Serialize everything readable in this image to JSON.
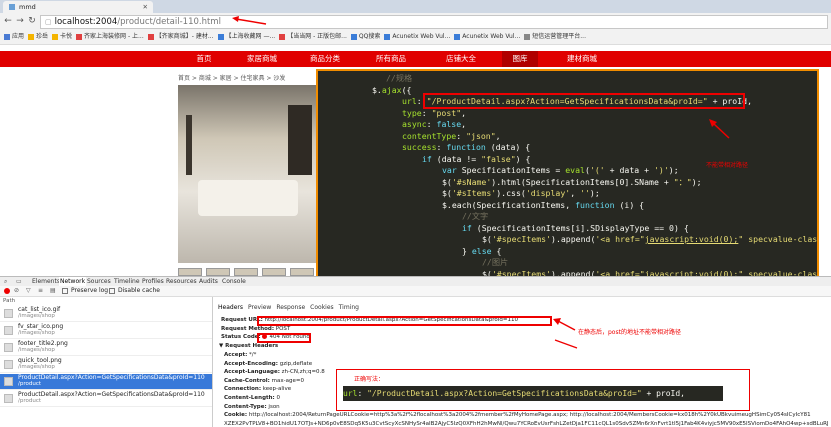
{
  "browser": {
    "tab_title": "mmd",
    "address_host": "localhost:2004",
    "address_path": "/product/detail-110.html",
    "bookmarks": [
      {
        "label": "应用",
        "color": "#4a7bd3"
      },
      {
        "label": "珍岳",
        "color": "#f4b400"
      },
      {
        "label": "卡悦",
        "color": "#f4b400"
      },
      {
        "label": "齐家上海装修网 - 上...",
        "color": "#e04040"
      },
      {
        "label": "【齐家商城】- 建材...",
        "color": "#e04040"
      },
      {
        "label": "【上海收藏网 —...",
        "color": "#3b7dd8"
      },
      {
        "label": "【当当网 - 正版包邮...",
        "color": "#e04040"
      },
      {
        "label": "QQ搜索",
        "color": "#3b7dd8"
      },
      {
        "label": "Acunetix Web Vul...",
        "color": "#3b7dd8"
      },
      {
        "label": "Acunetix Web Vul...",
        "color": "#3b7dd8"
      },
      {
        "label": "短信运营管理平台...",
        "color": "#888888"
      }
    ]
  },
  "site": {
    "nav": [
      "首页",
      "家居商城",
      "商品分类",
      "所有商品",
      "店铺大全",
      "图库",
      "建材商城"
    ],
    "breadcrumb": "首页 > 商城 > 家居 > 住宅家具 > 沙发"
  },
  "code_lines": [
    [
      [
        "cm",
        "//规格"
      ]
    ],
    [
      [
        "wh",
        "$."
      ],
      [
        "fn",
        "ajax"
      ],
      [
        "wh",
        "({"
      ]
    ],
    [
      [
        "prop",
        "url"
      ],
      [
        "wh",
        ": "
      ],
      [
        "str",
        "\"/ProductDetail.aspx?Action=GetSpecificationsData&proId=\""
      ],
      [
        "wh",
        " + proId,"
      ]
    ],
    [
      [
        "prop",
        "type"
      ],
      [
        "wh",
        ": "
      ],
      [
        "str",
        "\"post\""
      ],
      [
        "wh",
        ","
      ]
    ],
    [
      [
        "prop",
        "async"
      ],
      [
        "wh",
        ": "
      ],
      [
        "kw",
        "false"
      ],
      [
        "wh",
        ","
      ]
    ],
    [
      [
        "prop",
        "contentType"
      ],
      [
        "wh",
        ": "
      ],
      [
        "str",
        "\"json\""
      ],
      [
        "wh",
        ","
      ]
    ],
    [
      [
        "prop",
        "success"
      ],
      [
        "wh",
        ": "
      ],
      [
        "kw",
        "function"
      ],
      [
        "wh",
        " (data) {"
      ]
    ],
    [
      [
        "kw",
        "if"
      ],
      [
        "wh",
        " (data != "
      ],
      [
        "str",
        "\"false\""
      ],
      [
        "wh",
        ") {"
      ]
    ],
    [
      [
        "kw",
        "var"
      ],
      [
        "wh",
        " SpecificationItems = "
      ],
      [
        "fn",
        "eval"
      ],
      [
        "wh",
        "("
      ],
      [
        "str",
        "'('"
      ],
      [
        "wh",
        " + data + "
      ],
      [
        "str",
        "')'"
      ],
      [
        "wh",
        ");"
      ]
    ],
    [
      [
        "wh",
        "$("
      ],
      [
        "str",
        "'#sName'"
      ],
      [
        "wh",
        ").html(SpecificationItems[0].SName + "
      ],
      [
        "str",
        "\"：\""
      ],
      [
        "wh",
        ");"
      ]
    ],
    [
      [
        "wh",
        "$("
      ],
      [
        "str",
        "'#sItems'"
      ],
      [
        "wh",
        ").css("
      ],
      [
        "str",
        "'display'"
      ],
      [
        "wh",
        ", "
      ],
      [
        "str",
        "''"
      ],
      [
        "wh",
        ");"
      ]
    ],
    [
      [
        "wh",
        "$.each(SpecificationItems, "
      ],
      [
        "kw",
        "function"
      ],
      [
        "wh",
        " (i) {"
      ]
    ],
    [
      [
        "cm",
        "//文字"
      ]
    ],
    [
      [
        "kw",
        "if"
      ],
      [
        "wh",
        " (SpecificationItems[i].SDisplayType == 0) {"
      ]
    ],
    [
      [
        "wh",
        "$("
      ],
      [
        "str",
        "'#specItems'"
      ],
      [
        "wh",
        ").append("
      ],
      [
        "str",
        "'<a href=\""
      ],
      [
        "lnk",
        "javascript:void(0);"
      ],
      [
        "str",
        "\" specvalue-class=\"nor'"
      ]
    ],
    [
      [
        "wh",
        "} "
      ],
      [
        "kw",
        "else"
      ],
      [
        "wh",
        " {"
      ]
    ],
    [
      [
        "cm",
        "//图片"
      ]
    ],
    [
      [
        "wh",
        "$("
      ],
      [
        "str",
        "'#specItems'"
      ],
      [
        "wh",
        ").append("
      ],
      [
        "str",
        "'<a href=\""
      ],
      [
        "lnk",
        "javascript:void(0);"
      ],
      [
        "str",
        "\" specvalue-class=\"nor'"
      ]
    ]
  ],
  "code_annotation": "不能带相对路径",
  "devtools": {
    "tabs": [
      "Elements",
      "Network",
      "Sources",
      "Timeline",
      "Profiles",
      "Resources",
      "Audits",
      "Console"
    ],
    "toolbar": {
      "preserve_log": "Preserve log",
      "disable_cache": "Disable cache"
    },
    "path_label": "Path",
    "requests": [
      {
        "name": "cat_list_ico.gif",
        "path": "/images/shop"
      },
      {
        "name": "fv_star_ico.png",
        "path": "/images/shop"
      },
      {
        "name": "footer_title2.png",
        "path": "/images/shop"
      },
      {
        "name": "quick_tool.png",
        "path": "/images/shop"
      },
      {
        "name": "ProductDetail.aspx?Action=GetSpecificationsData&proId=110",
        "path": "/product"
      },
      {
        "name": "ProductDetail.aspx?Action=GetSpecificationsData&proId=110",
        "path": "/product"
      }
    ],
    "header_tabs": [
      "Headers",
      "Preview",
      "Response",
      "Cookies",
      "Timing"
    ],
    "general": [
      {
        "key": "Request URL:",
        "value": "http://localhost:2004/product/ProductDetail.aspx?Action=GetSpecificationsData&proId=110"
      },
      {
        "key": "Request Method:",
        "value": "POST"
      },
      {
        "key": "Status Code:",
        "value": "404 Not Found"
      }
    ],
    "request_headers_title": "▼ Request Headers",
    "request_headers": [
      {
        "key": "Accept:",
        "value": "*/*"
      },
      {
        "key": "Accept-Encoding:",
        "value": "gzip,deflate"
      },
      {
        "key": "Accept-Language:",
        "value": "zh-CN,zh;q=0.8"
      },
      {
        "key": "Cache-Control:",
        "value": "max-age=0"
      },
      {
        "key": "Connection:",
        "value": "keep-alive"
      },
      {
        "key": "Content-Length:",
        "value": "0"
      },
      {
        "key": "Content-Type:",
        "value": "json"
      },
      {
        "key": "Cookie:",
        "value": "http://localhost:2004/ReturnPageURLCookie=http%3a%2f%2flocalhost%3a2004%2fmember%2fMyHomePage.aspx; http://localhost:2004/MembersCookie=kx018h%2Y0kUBkvuimeugHSimCy054sICyIcY81"
      },
      {
        "key": "",
        "value": "XZEX2PvTPLV8+BO1hidU17OTJs+ND6p0vE8SDq5K5u3CvtScyXcSNHySr4aIB2AjyC5IzQ0XFhH2hMwNl/Qwu7YCRoEvUsrFshLZetDja1FC11cQL1s0Sdv5ZMn6rXnFvrt1tI5j1Fab4K4viyjc5MV90xE5ISViomDo4FAhO4wp+sdBLuRJ"
      }
    ],
    "annotation_right": "在静态后，post的地址不能带相对路径",
    "correct_title": "正确写法：",
    "correct_code": [
      [
        "prop",
        "url"
      ],
      [
        "wh",
        ": "
      ],
      [
        "str",
        "\"/ProductDetail.aspx?Action=GetSpecificationsData&proId=\""
      ],
      [
        "wh",
        " + proId,"
      ]
    ]
  }
}
